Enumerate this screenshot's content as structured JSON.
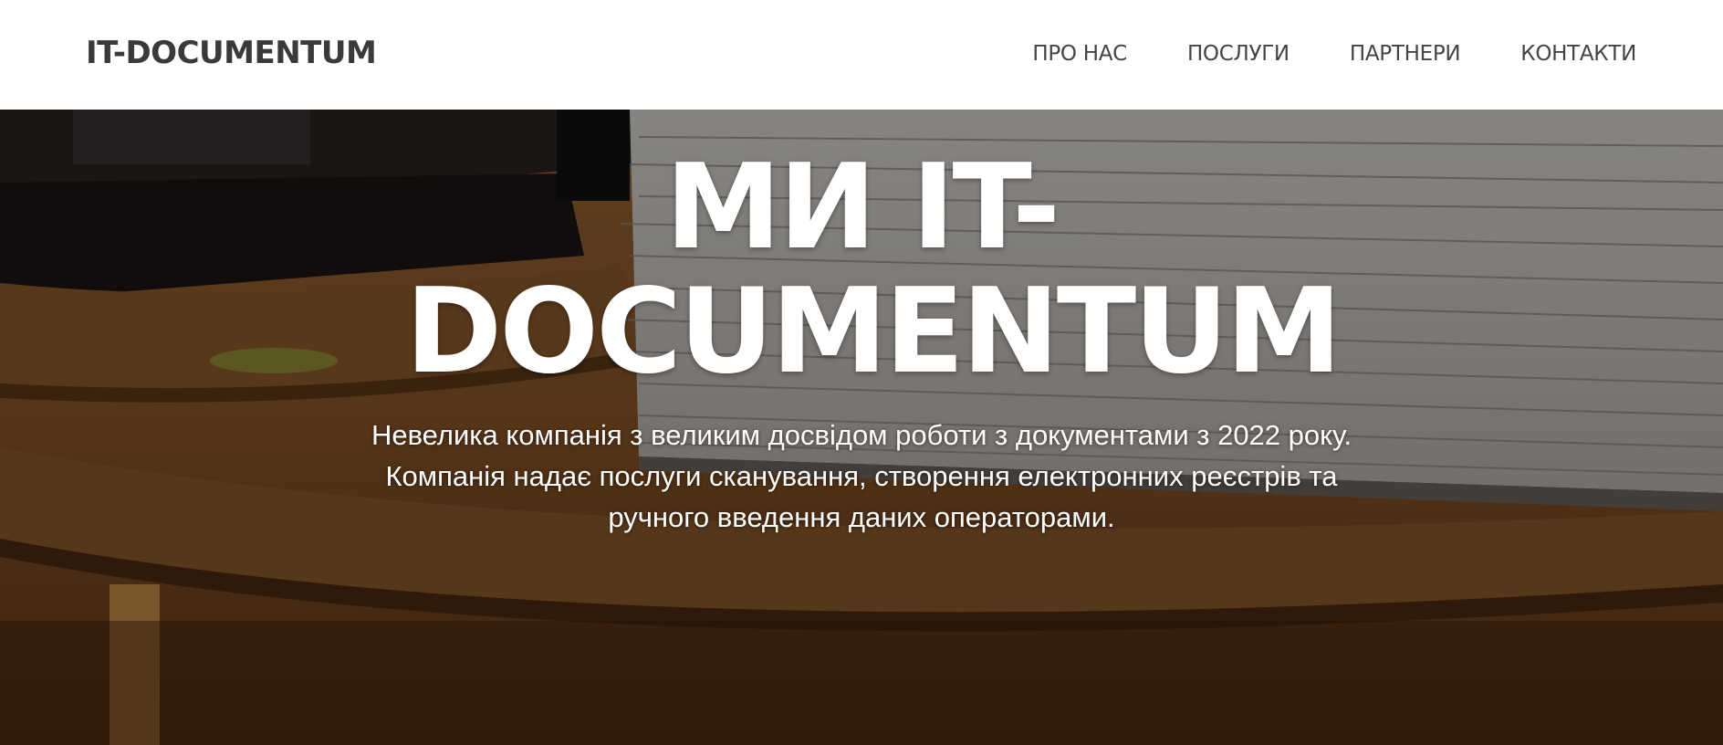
{
  "navbar": {
    "brand": "IT-DOCUMENTUM",
    "links": [
      {
        "label": "ПРО НАС"
      },
      {
        "label": "ПОСЛУГИ"
      },
      {
        "label": "ПАРТНЕРИ"
      },
      {
        "label": "КОНТАКТИ"
      }
    ]
  },
  "hero": {
    "title": "МИ IT-DOCUMENTUM",
    "subtitle": "Невелика компанія з великим досвідом роботи з документами з 2022 року. Компанія надає послуги сканування, створення електронних реєстрів та ручного введення даних операторами.",
    "background_image": "photo-of-paper-document-stacks-on-wooden-desk",
    "colors": {
      "text": "#ffffff",
      "desk_wood": "#8a5a2e",
      "overlay": "#000000"
    }
  }
}
